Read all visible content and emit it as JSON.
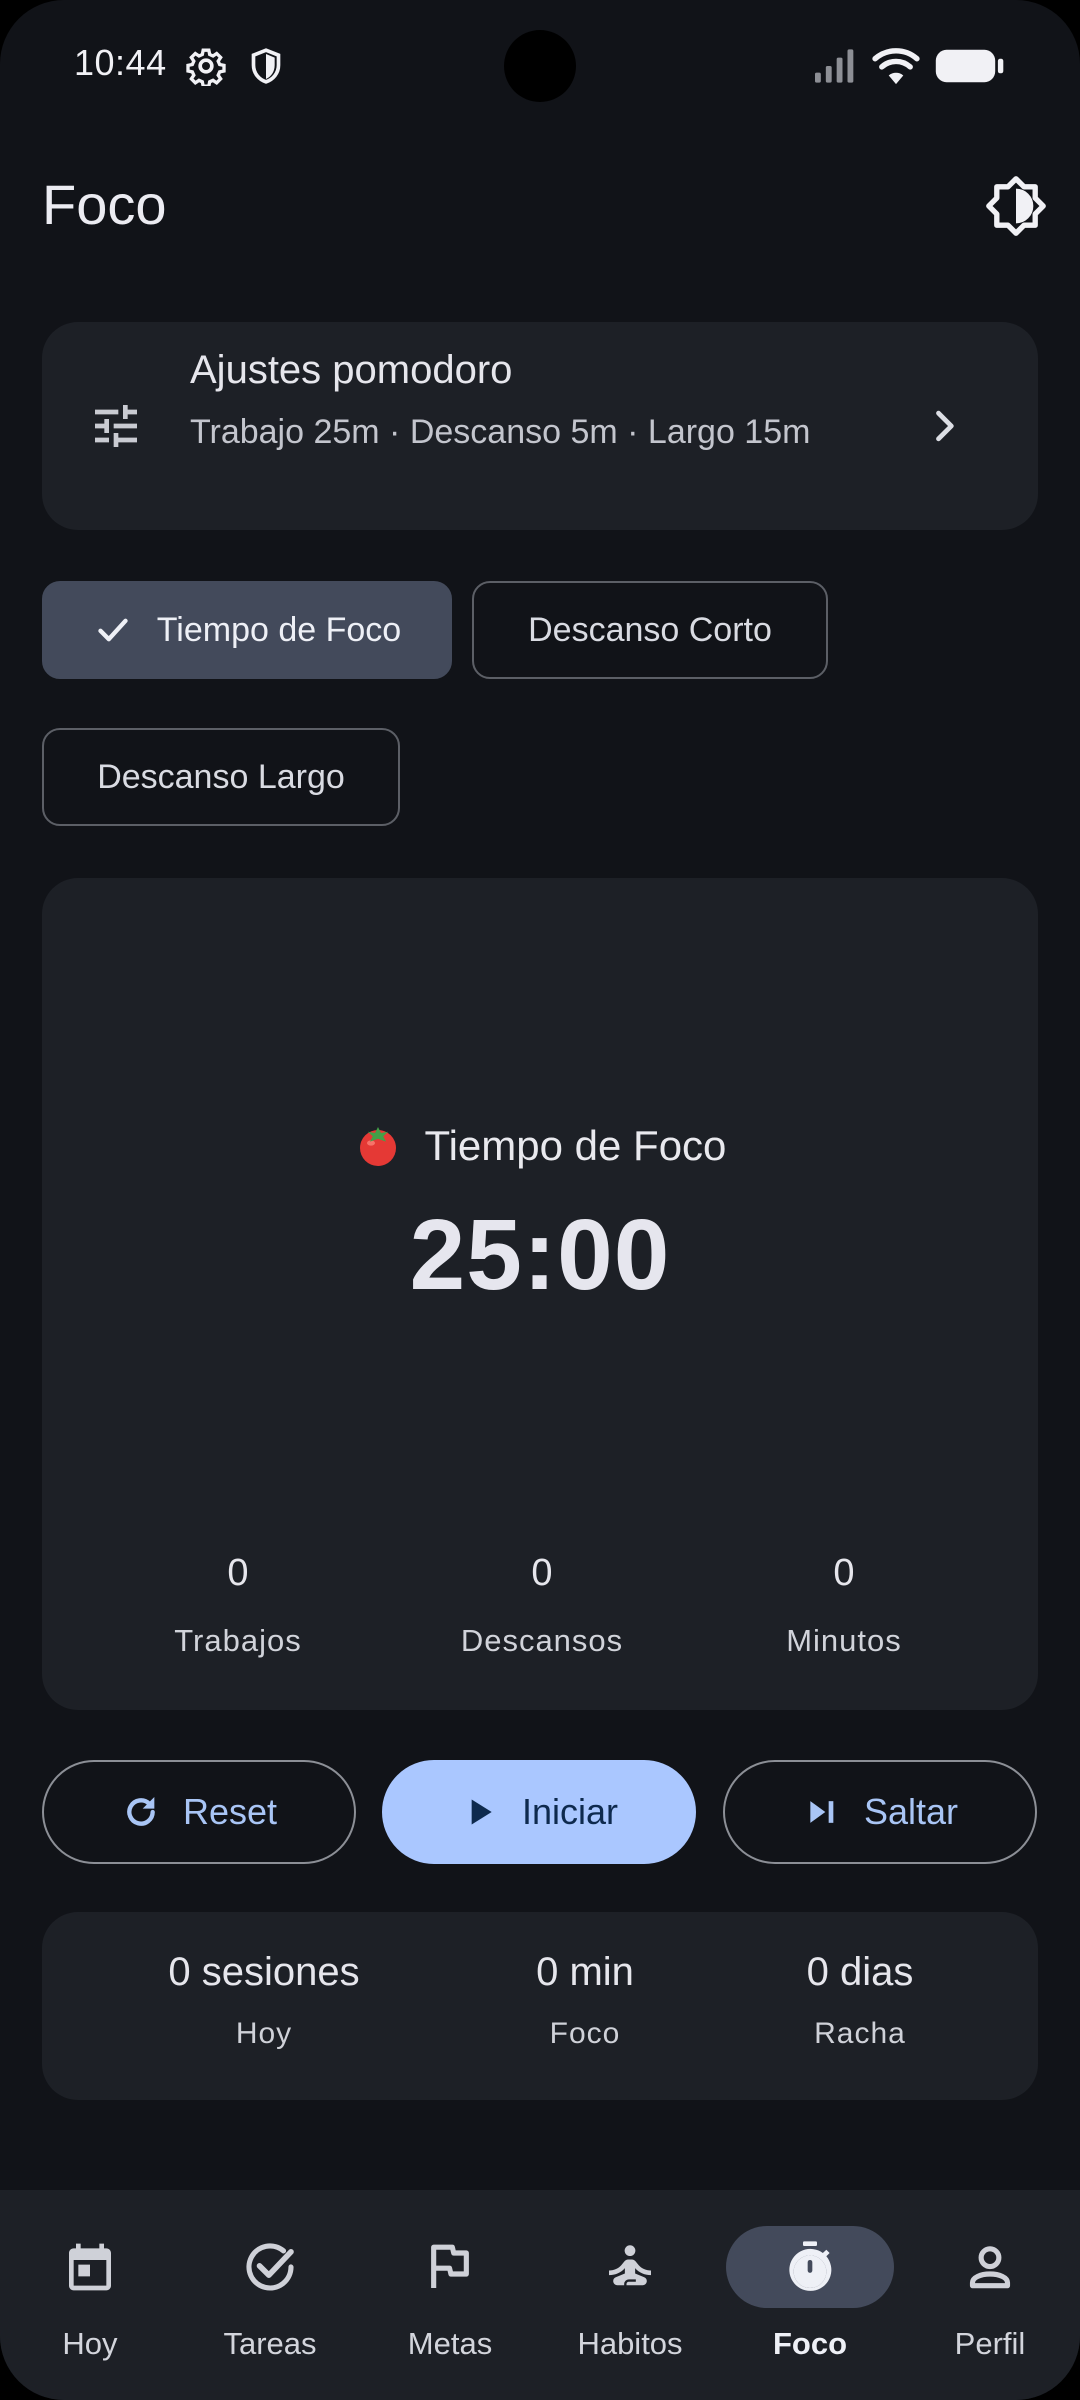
{
  "status_bar": {
    "time": "10:44",
    "icons": [
      "settings-icon",
      "shield-icon",
      "signal-icon",
      "wifi-icon",
      "battery-icon"
    ]
  },
  "app_bar": {
    "title": "Foco",
    "action_icon": "brightness-icon"
  },
  "settings_card": {
    "title": "Ajustes pomodoro",
    "subtitle": "Trabajo 25m · Descanso 5m · Largo 15m"
  },
  "mode_chips": [
    {
      "label": "Tiempo de Foco",
      "selected": true
    },
    {
      "label": "Descanso Corto",
      "selected": false
    },
    {
      "label": "Descanso Largo",
      "selected": false
    }
  ],
  "timer": {
    "emoji": "tomato-icon",
    "mode_label": "Tiempo de Foco",
    "time": "25:00",
    "stats": [
      {
        "value": "0",
        "label": "Trabajos"
      },
      {
        "value": "0",
        "label": "Descansos"
      },
      {
        "value": "0",
        "label": "Minutos"
      }
    ]
  },
  "controls": {
    "reset": "Reset",
    "start": "Iniciar",
    "skip": "Saltar"
  },
  "summary": [
    {
      "value": "0 sesiones",
      "label": "Hoy"
    },
    {
      "value": "0 min",
      "label": "Foco"
    },
    {
      "value": "0 dias",
      "label": "Racha"
    }
  ],
  "nav": [
    {
      "label": "Hoy",
      "icon": "calendar-icon",
      "active": false
    },
    {
      "label": "Tareas",
      "icon": "check-circle-icon",
      "active": false
    },
    {
      "label": "Metas",
      "icon": "flag-icon",
      "active": false
    },
    {
      "label": "Habitos",
      "icon": "meditation-icon",
      "active": false
    },
    {
      "label": "Foco",
      "icon": "timer-icon",
      "active": true
    },
    {
      "label": "Perfil",
      "icon": "person-icon",
      "active": false
    }
  ],
  "colors": {
    "background": "#111318",
    "card": "#1d2026",
    "accent": "#aac7ff",
    "selected": "#434a5b"
  }
}
